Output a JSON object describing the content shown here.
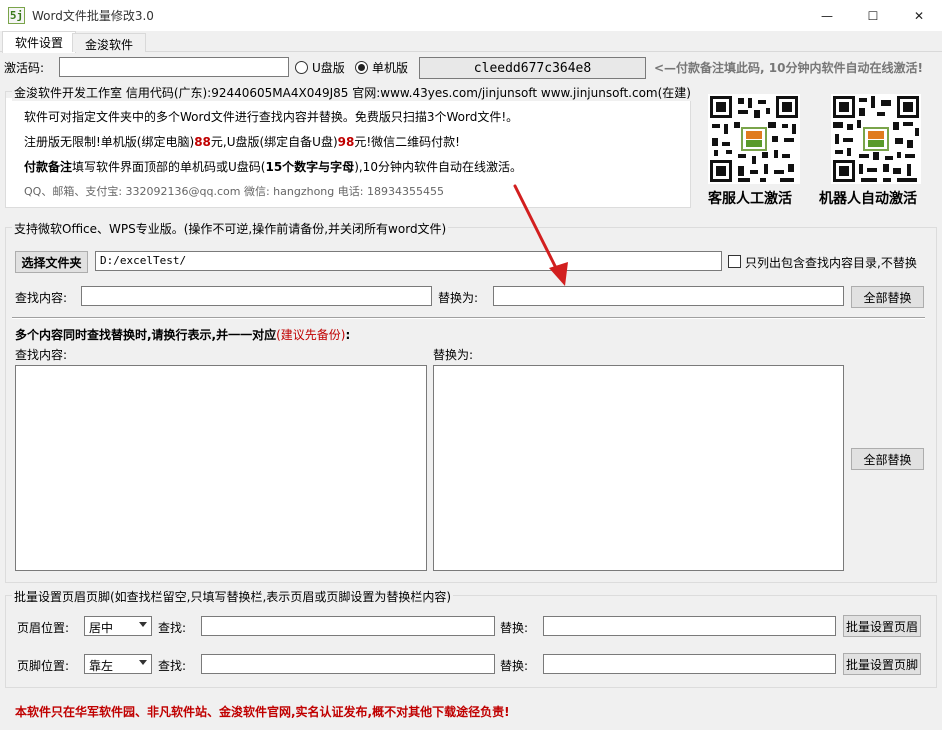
{
  "window": {
    "title": "Word文件批量修改3.0",
    "icon_text": "5j",
    "minimize": "—",
    "maximize": "☐",
    "close": "✕"
  },
  "tabs": [
    {
      "label": "软件设置"
    },
    {
      "label": "金浚软件"
    }
  ],
  "activation": {
    "label": "激活码:",
    "code_value": "",
    "radio_usb": "U盘版",
    "radio_pc": "单机版",
    "machine_code": "cleedd677c364e8",
    "notice": "<—付款备注填此码, 10分钟内软件自动在线激活!"
  },
  "info": {
    "header": "金浚软件开发工作室 信用代码(广东):92440605MA4X049J85 官网:www.43yes.com/jinjunsoft  www.jinjunsoft.com(在建)",
    "line1": "软件可对指定文件夹中的多个Word文件进行查找内容并替换。免费版只扫描3个Word文件!。",
    "line2_a": "注册版无限制!单机版(绑定电脑)",
    "line2_price1": "88",
    "line2_b": "元,U盘版(绑定自备U盘)",
    "line2_price2": "98",
    "line2_c": "元!微信二维码付款!",
    "line3_a": "付款备注",
    "line3_b": "填写软件界面顶部的单机码或U盘码(",
    "line3_c": "15个数字与字母",
    "line3_d": "),10分钟内软件自动在线激活。",
    "line4": "QQ、邮箱、支付宝: 332092136@qq.com   微信: hangzhong   电话: 18934355455"
  },
  "qrcodes": [
    {
      "label": "客服人工激活"
    },
    {
      "label": "机器人自动激活"
    }
  ],
  "single": {
    "legend": "支持微软Office、WPS专业版。(操作不可逆,操作前请备份,并关闭所有word文件)",
    "choose_folder": "选择文件夹",
    "folder_path": "D:/excelTest/",
    "checkbox_label": "只列出包含查找内容目录,不替换",
    "find_label": "查找内容:",
    "find_value": "",
    "replace_label": "替换为:",
    "replace_value": "",
    "replace_all": "全部替换"
  },
  "multi": {
    "heading_a": "多个内容同时查找替换时,请换行表示,并一一对应",
    "heading_b": "(建议先备份)",
    "heading_c": ":",
    "find_label": "查找内容:",
    "replace_label": "替换为:",
    "replace_all": "全部替换"
  },
  "headerfooter": {
    "legend": "批量设置页眉页脚(如查找栏留空,只填写替换栏,表示页眉或页脚设置为替换栏内容)",
    "header_pos_label": "页眉位置:",
    "header_pos_value": "居中",
    "footer_pos_label": "页脚位置:",
    "footer_pos_value": "靠左",
    "find_label": "查找:",
    "replace_label": "替换:",
    "set_header": "批量设置页眉",
    "set_footer": "批量设置页脚"
  },
  "footer_notice": "本软件只在华军软件园、非凡软件站、金浚软件官网,实名认证发布,概不对其他下载途径负责!",
  "colors": {
    "red": "#c00000",
    "arrow": "#d21f1f"
  }
}
